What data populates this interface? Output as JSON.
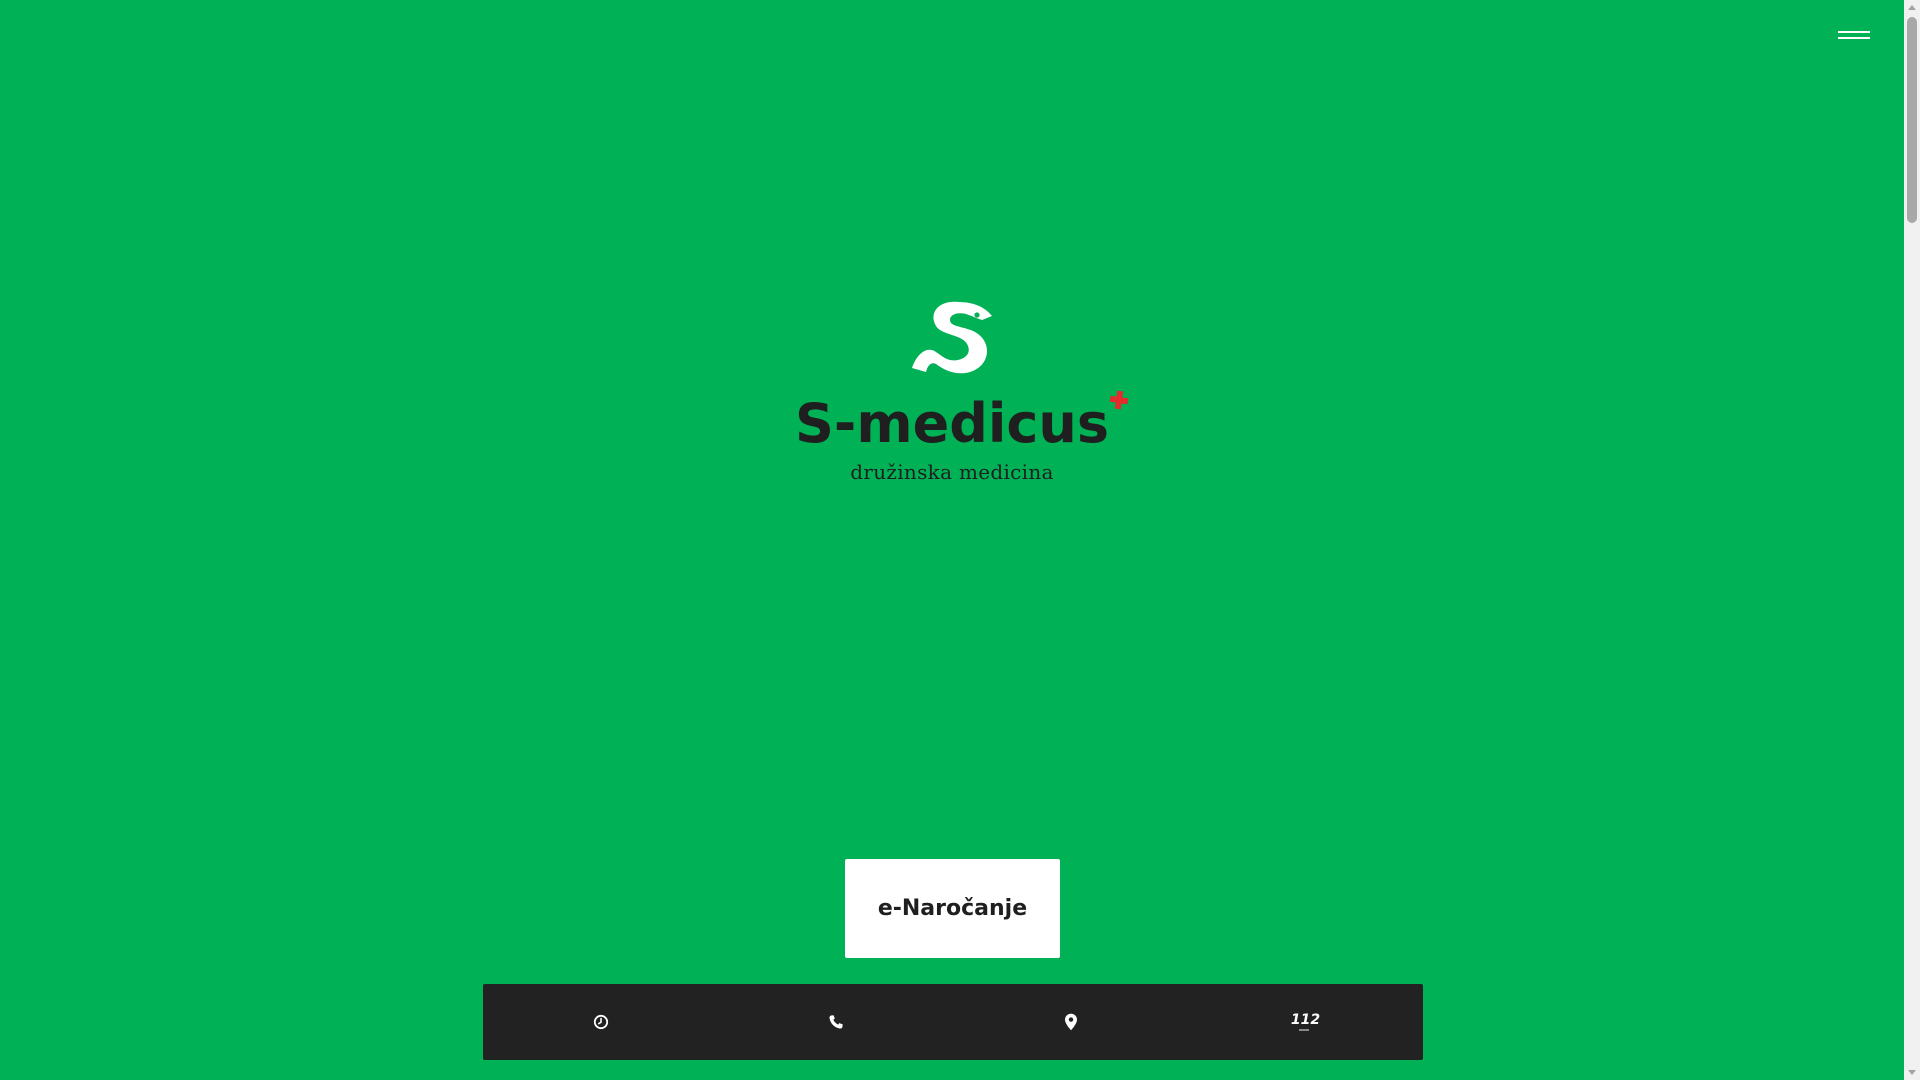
{
  "brand": {
    "name": "S-medicus",
    "tagline": "družinska medicina"
  },
  "cta": {
    "label": "e-Naročanje"
  },
  "info_bar": {
    "items": [
      {
        "icon": "clock-icon"
      },
      {
        "icon": "phone-icon"
      },
      {
        "icon": "map-pin-icon"
      },
      {
        "icon": "emergency-112-icon",
        "label": "112"
      }
    ]
  },
  "colors": {
    "background": "#00b156",
    "text_dark": "#1f1f1f",
    "bar": "#222222",
    "accent_red": "#e52b2b",
    "button_bg": "#ffffff"
  }
}
